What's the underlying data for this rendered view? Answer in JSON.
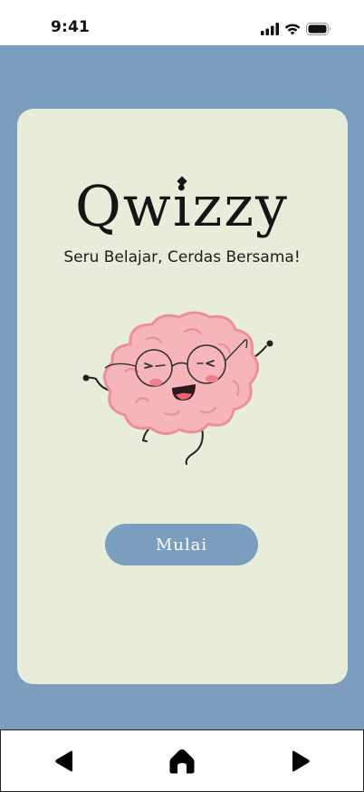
{
  "status_bar": {
    "time": "9:41",
    "icons": [
      "signal-icon",
      "wifi-icon",
      "battery-icon"
    ]
  },
  "app": {
    "title": "Qwizzy",
    "tagline": "Seru Belajar, Cerdas Bersama!",
    "mascot": "brain-mascot-icon",
    "start_button_label": "Mulai"
  },
  "bottom_nav": {
    "items": [
      "back-icon",
      "home-icon",
      "forward-icon"
    ]
  },
  "colors": {
    "background": "#7b9ebf",
    "card": "#e8eddb",
    "button": "#7b9ebf",
    "text": "#151515",
    "brain": "#f5b5bb"
  }
}
